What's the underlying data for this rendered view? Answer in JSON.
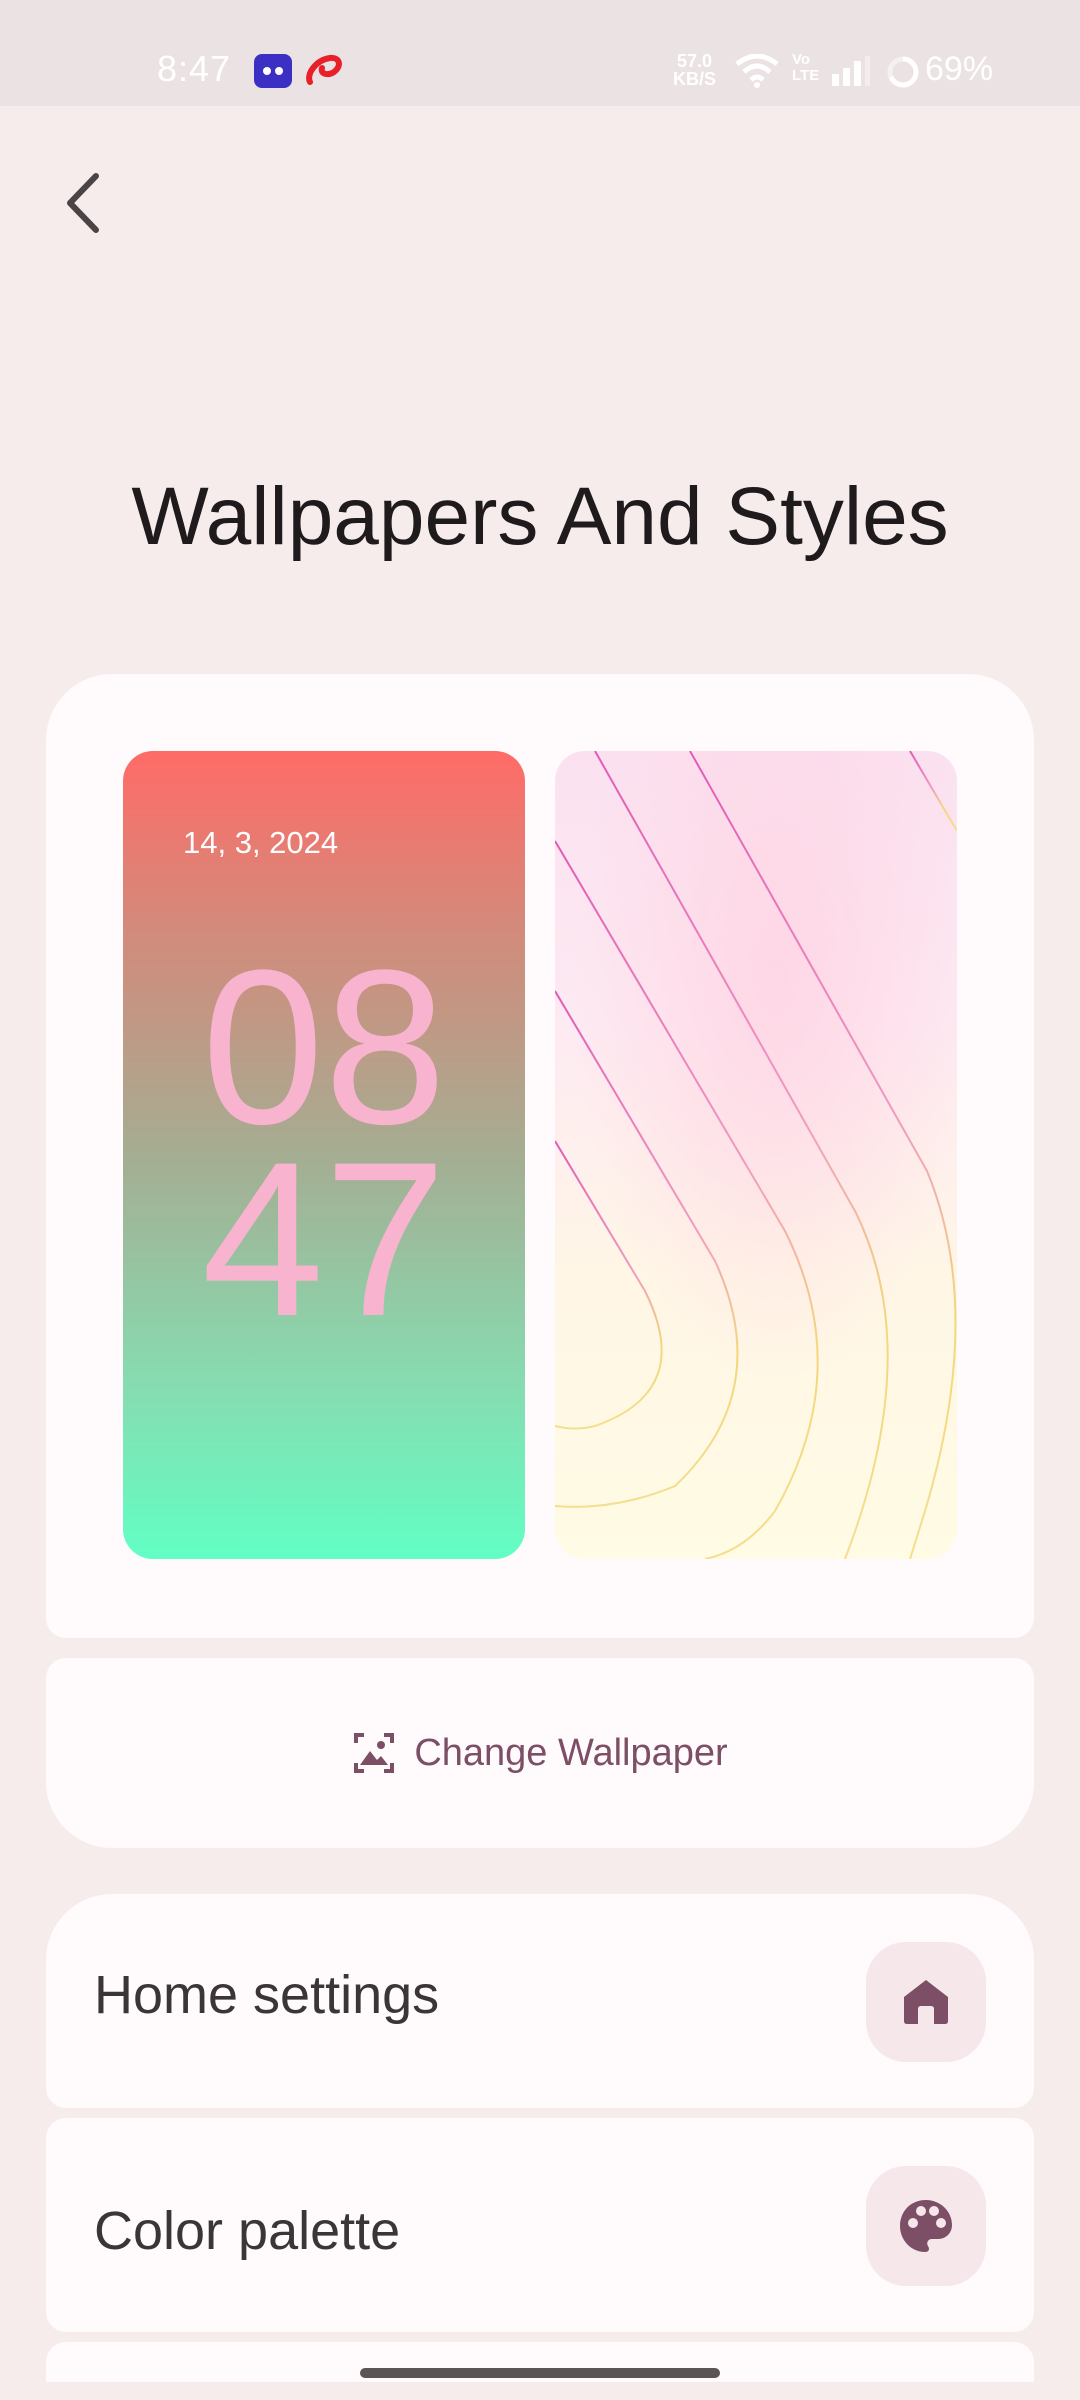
{
  "status_bar": {
    "time": "8:47",
    "net_speed_value": "57.0",
    "net_speed_unit": "KB/S",
    "volte_top": "Vo",
    "volte_bottom": "LTE",
    "battery": "69%",
    "icons": [
      "game-app-icon",
      "airtel-icon",
      "wifi-icon",
      "signal-icon",
      "battery-ring-icon"
    ]
  },
  "header": {
    "back_icon": "chevron-left-icon",
    "title": "Wallpapers And Styles"
  },
  "preview": {
    "lock_screen": {
      "date": "14, 3, 2024",
      "hour": "08",
      "minute": "47"
    }
  },
  "change_wallpaper": {
    "icon": "wallpaper-icon",
    "label": "Change Wallpaper"
  },
  "settings": [
    {
      "label": "Home settings",
      "icon": "home-icon"
    },
    {
      "label": "Color palette",
      "icon": "palette-icon"
    }
  ],
  "colors": {
    "background": "#f6ecec",
    "card": "#fffafb",
    "accent": "#7c4f66",
    "icon_bg": "#f6e8ea",
    "lock_clock": "#f8b3cf"
  }
}
